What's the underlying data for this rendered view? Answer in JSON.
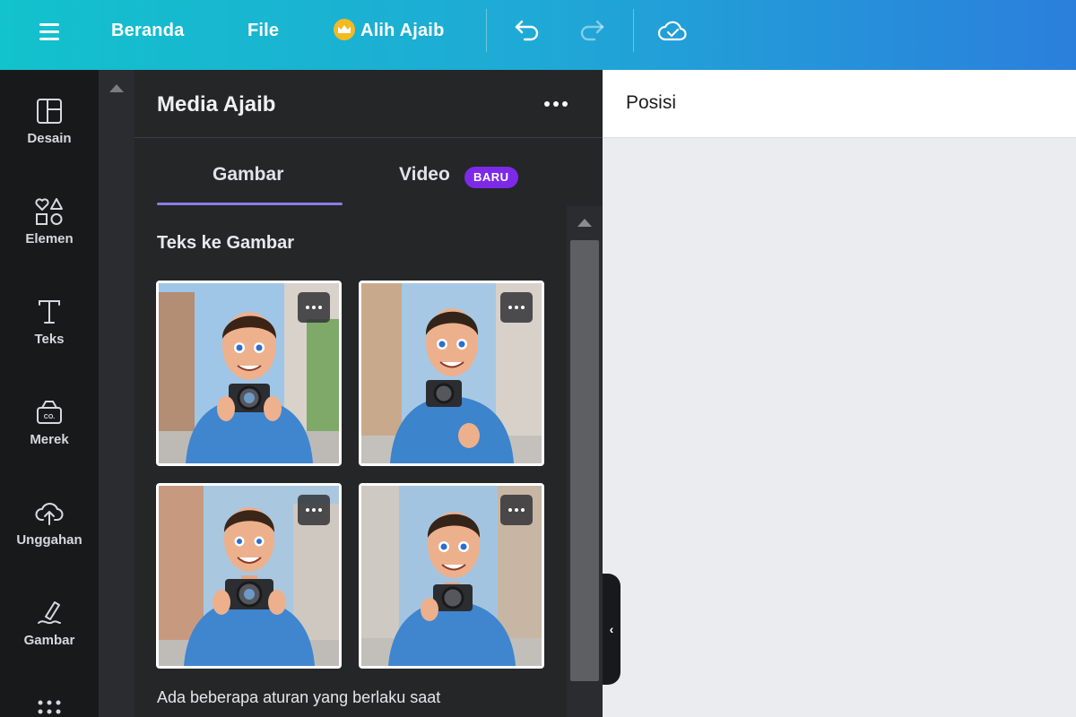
{
  "topbar": {
    "menu_icon": "hamburger-icon",
    "home": "Beranda",
    "file": "File",
    "magic_switch": "Alih Ajaib",
    "magic_switch_icon": "crown-icon",
    "undo_icon": "undo-icon",
    "redo_icon": "redo-icon",
    "save_status_icon": "cloud-check-icon"
  },
  "rail": {
    "items": [
      {
        "label": "Desain",
        "icon": "layout-icon"
      },
      {
        "label": "Elemen",
        "icon": "shapes-icon"
      },
      {
        "label": "Teks",
        "icon": "text-icon"
      },
      {
        "label": "Merek",
        "icon": "brand-icon"
      },
      {
        "label": "Unggahan",
        "icon": "cloud-upload-icon"
      },
      {
        "label": "Gambar",
        "icon": "draw-icon"
      }
    ],
    "more_icon": "apps-grid-icon"
  },
  "panel": {
    "title": "Media Ajaib",
    "tabs": [
      {
        "label": "Gambar",
        "active": true
      },
      {
        "label": "Video",
        "badge": "BARU"
      }
    ],
    "section_title": "Teks ke Gambar",
    "images": [
      {
        "alt": "3D cartoon man with camera 1"
      },
      {
        "alt": "3D cartoon man with camera 2"
      },
      {
        "alt": "3D cartoon man with camera 3"
      },
      {
        "alt": "3D cartoon man with camera 4"
      }
    ],
    "help_text": "Ada beberapa aturan yang berlaku saat"
  },
  "editor": {
    "position_button": "Posisi"
  },
  "colors": {
    "topbar_start": "#12c2cc",
    "topbar_end": "#2b7fdc",
    "accent_purple": "#7d2ae8",
    "tab_underline": "#8b7de8",
    "panel_bg": "#252627",
    "rail_bg": "#18191b"
  }
}
